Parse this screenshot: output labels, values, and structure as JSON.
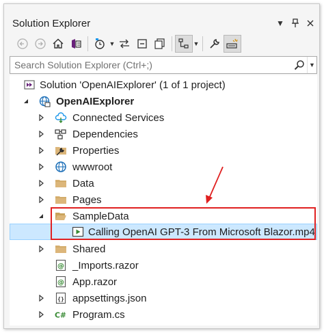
{
  "window": {
    "title": "Solution Explorer"
  },
  "search": {
    "placeholder": "Search Solution Explorer (Ctrl+;)"
  },
  "tree": {
    "solution_label": "Solution 'OpenAIExplorer' (1 of 1 project)",
    "project_label": "OpenAIExplorer",
    "items": [
      {
        "label": "Connected Services",
        "icon": "connected-services-icon"
      },
      {
        "label": "Dependencies",
        "icon": "dependencies-icon"
      },
      {
        "label": "Properties",
        "icon": "wrench-folder-icon"
      },
      {
        "label": "wwwroot",
        "icon": "globe-icon"
      },
      {
        "label": "Data",
        "icon": "folder-icon"
      },
      {
        "label": "Pages",
        "icon": "folder-icon"
      },
      {
        "label": "SampleData",
        "icon": "folder-open-icon"
      },
      {
        "label": "Calling OpenAI GPT-3 From Microsoft Blazor.mp4",
        "icon": "video-file-icon"
      },
      {
        "label": "Shared",
        "icon": "folder-icon"
      },
      {
        "label": "_Imports.razor",
        "icon": "razor-file-icon"
      },
      {
        "label": "App.razor",
        "icon": "razor-file-icon"
      },
      {
        "label": "appsettings.json",
        "icon": "json-file-icon"
      },
      {
        "label": "Program.cs",
        "icon": "csharp-file-icon"
      }
    ]
  },
  "colors": {
    "selection": "#cce8ff",
    "annotation": "#e02020",
    "folder": "#dcb67a"
  }
}
